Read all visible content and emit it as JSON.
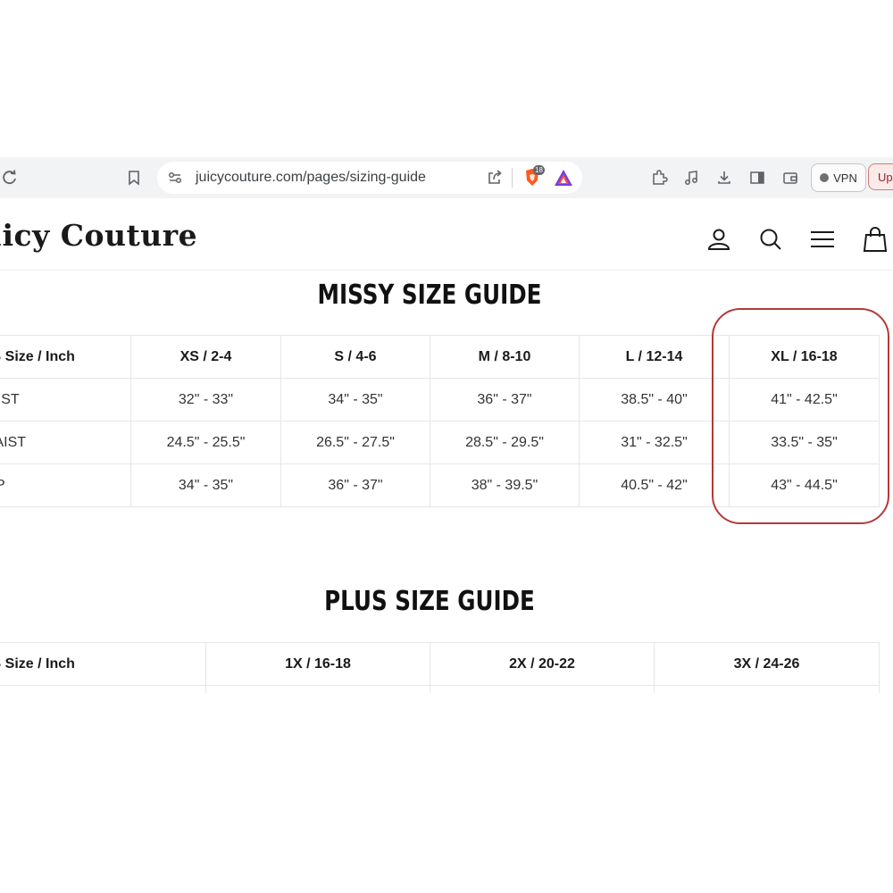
{
  "browser": {
    "url": "juicycouture.com/pages/sizing-guide",
    "brave_badge_count": "18",
    "vpn_label": "VPN",
    "update_label": "Up"
  },
  "site": {
    "logo": "uicy Couture"
  },
  "missy": {
    "title": "MISSY SIZE GUIDE",
    "header": [
      "US Size / Inch",
      "XS / 2-4",
      "S / 4-6",
      "M / 8-10",
      "L / 12-14",
      "XL / 16-18"
    ],
    "rows": [
      [
        "BUST",
        "32\" - 33\"",
        "34\" - 35\"",
        "36\" - 37\"",
        "38.5\" - 40\"",
        "41\" - 42.5\""
      ],
      [
        "WAIST",
        "24.5\" - 25.5\"",
        "26.5\" - 27.5\"",
        "28.5\" - 29.5\"",
        "31\" - 32.5\"",
        "33.5\" - 35\""
      ],
      [
        "HIP",
        "34\" - 35\"",
        "36\" - 37\"",
        "38\" - 39.5\"",
        "40.5\" - 42\"",
        "43\" - 44.5\""
      ]
    ]
  },
  "plus": {
    "title": "PLUS SIZE GUIDE",
    "header": [
      "US Size / Inch",
      "1X / 16-18",
      "2X / 20-22",
      "3X / 24-26"
    ]
  },
  "colors": {
    "highlight": "#b23a3a",
    "toolbar_bg": "#f1f3f4",
    "grid": "#e6e6e6"
  }
}
